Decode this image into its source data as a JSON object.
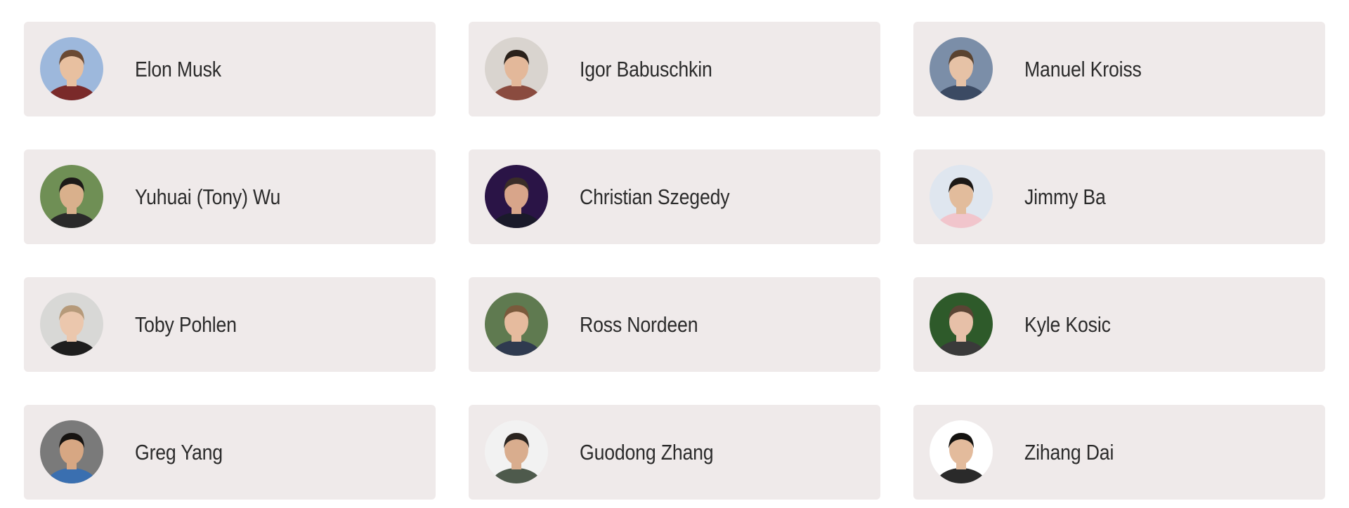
{
  "people": [
    {
      "name": "Elon Musk",
      "avatar": {
        "bg": "#9db8dc",
        "skin": "#e8c0a0",
        "hair": "#6b4a33",
        "shirt": "#7a2a2a"
      }
    },
    {
      "name": "Igor Babuschkin",
      "avatar": {
        "bg": "#d9d4cf",
        "skin": "#e3b89a",
        "hair": "#2a211b",
        "shirt": "#8a4b3f"
      }
    },
    {
      "name": "Manuel Kroiss",
      "avatar": {
        "bg": "#7b8ea8",
        "skin": "#e6c2a6",
        "hair": "#5a4330",
        "shirt": "#3b4a63"
      }
    },
    {
      "name": "Yuhuai (Tony) Wu",
      "avatar": {
        "bg": "#6f8f55",
        "skin": "#d9b08c",
        "hair": "#1d1a18",
        "shirt": "#2a2a2a"
      }
    },
    {
      "name": "Christian Szegedy",
      "avatar": {
        "bg": "#2a1446",
        "skin": "#d8a58a",
        "hair": "#3a2d28",
        "shirt": "#1a1a2a"
      }
    },
    {
      "name": "Jimmy Ba",
      "avatar": {
        "bg": "#dfe6ef",
        "skin": "#e2bc9c",
        "hair": "#1c1815",
        "shirt": "#f1c5cc"
      }
    },
    {
      "name": "Toby Pohlen",
      "avatar": {
        "bg": "#d8d8d6",
        "skin": "#ebc7ad",
        "hair": "#b69a7a",
        "shirt": "#1e1e1e"
      }
    },
    {
      "name": "Ross Nordeen",
      "avatar": {
        "bg": "#5f7a50",
        "skin": "#e6bb9e",
        "hair": "#7a5a3c",
        "shirt": "#2f3a4f"
      }
    },
    {
      "name": "Kyle Kosic",
      "avatar": {
        "bg": "#2e5a2a",
        "skin": "#e7c0a8",
        "hair": "#5a4434",
        "shirt": "#3a3a3a"
      }
    },
    {
      "name": "Greg Yang",
      "avatar": {
        "bg": "#7a7a7a",
        "skin": "#d7a783",
        "hair": "#161311",
        "shirt": "#3a6fb0"
      }
    },
    {
      "name": "Guodong Zhang",
      "avatar": {
        "bg": "#f2f2f2",
        "skin": "#d9ad8e",
        "hair": "#2a2420",
        "shirt": "#4e5a4c"
      }
    },
    {
      "name": "Zihang Dai",
      "avatar": {
        "bg": "#ffffff",
        "skin": "#e3bb9c",
        "hair": "#141210",
        "shirt": "#2a2a2a"
      }
    }
  ]
}
